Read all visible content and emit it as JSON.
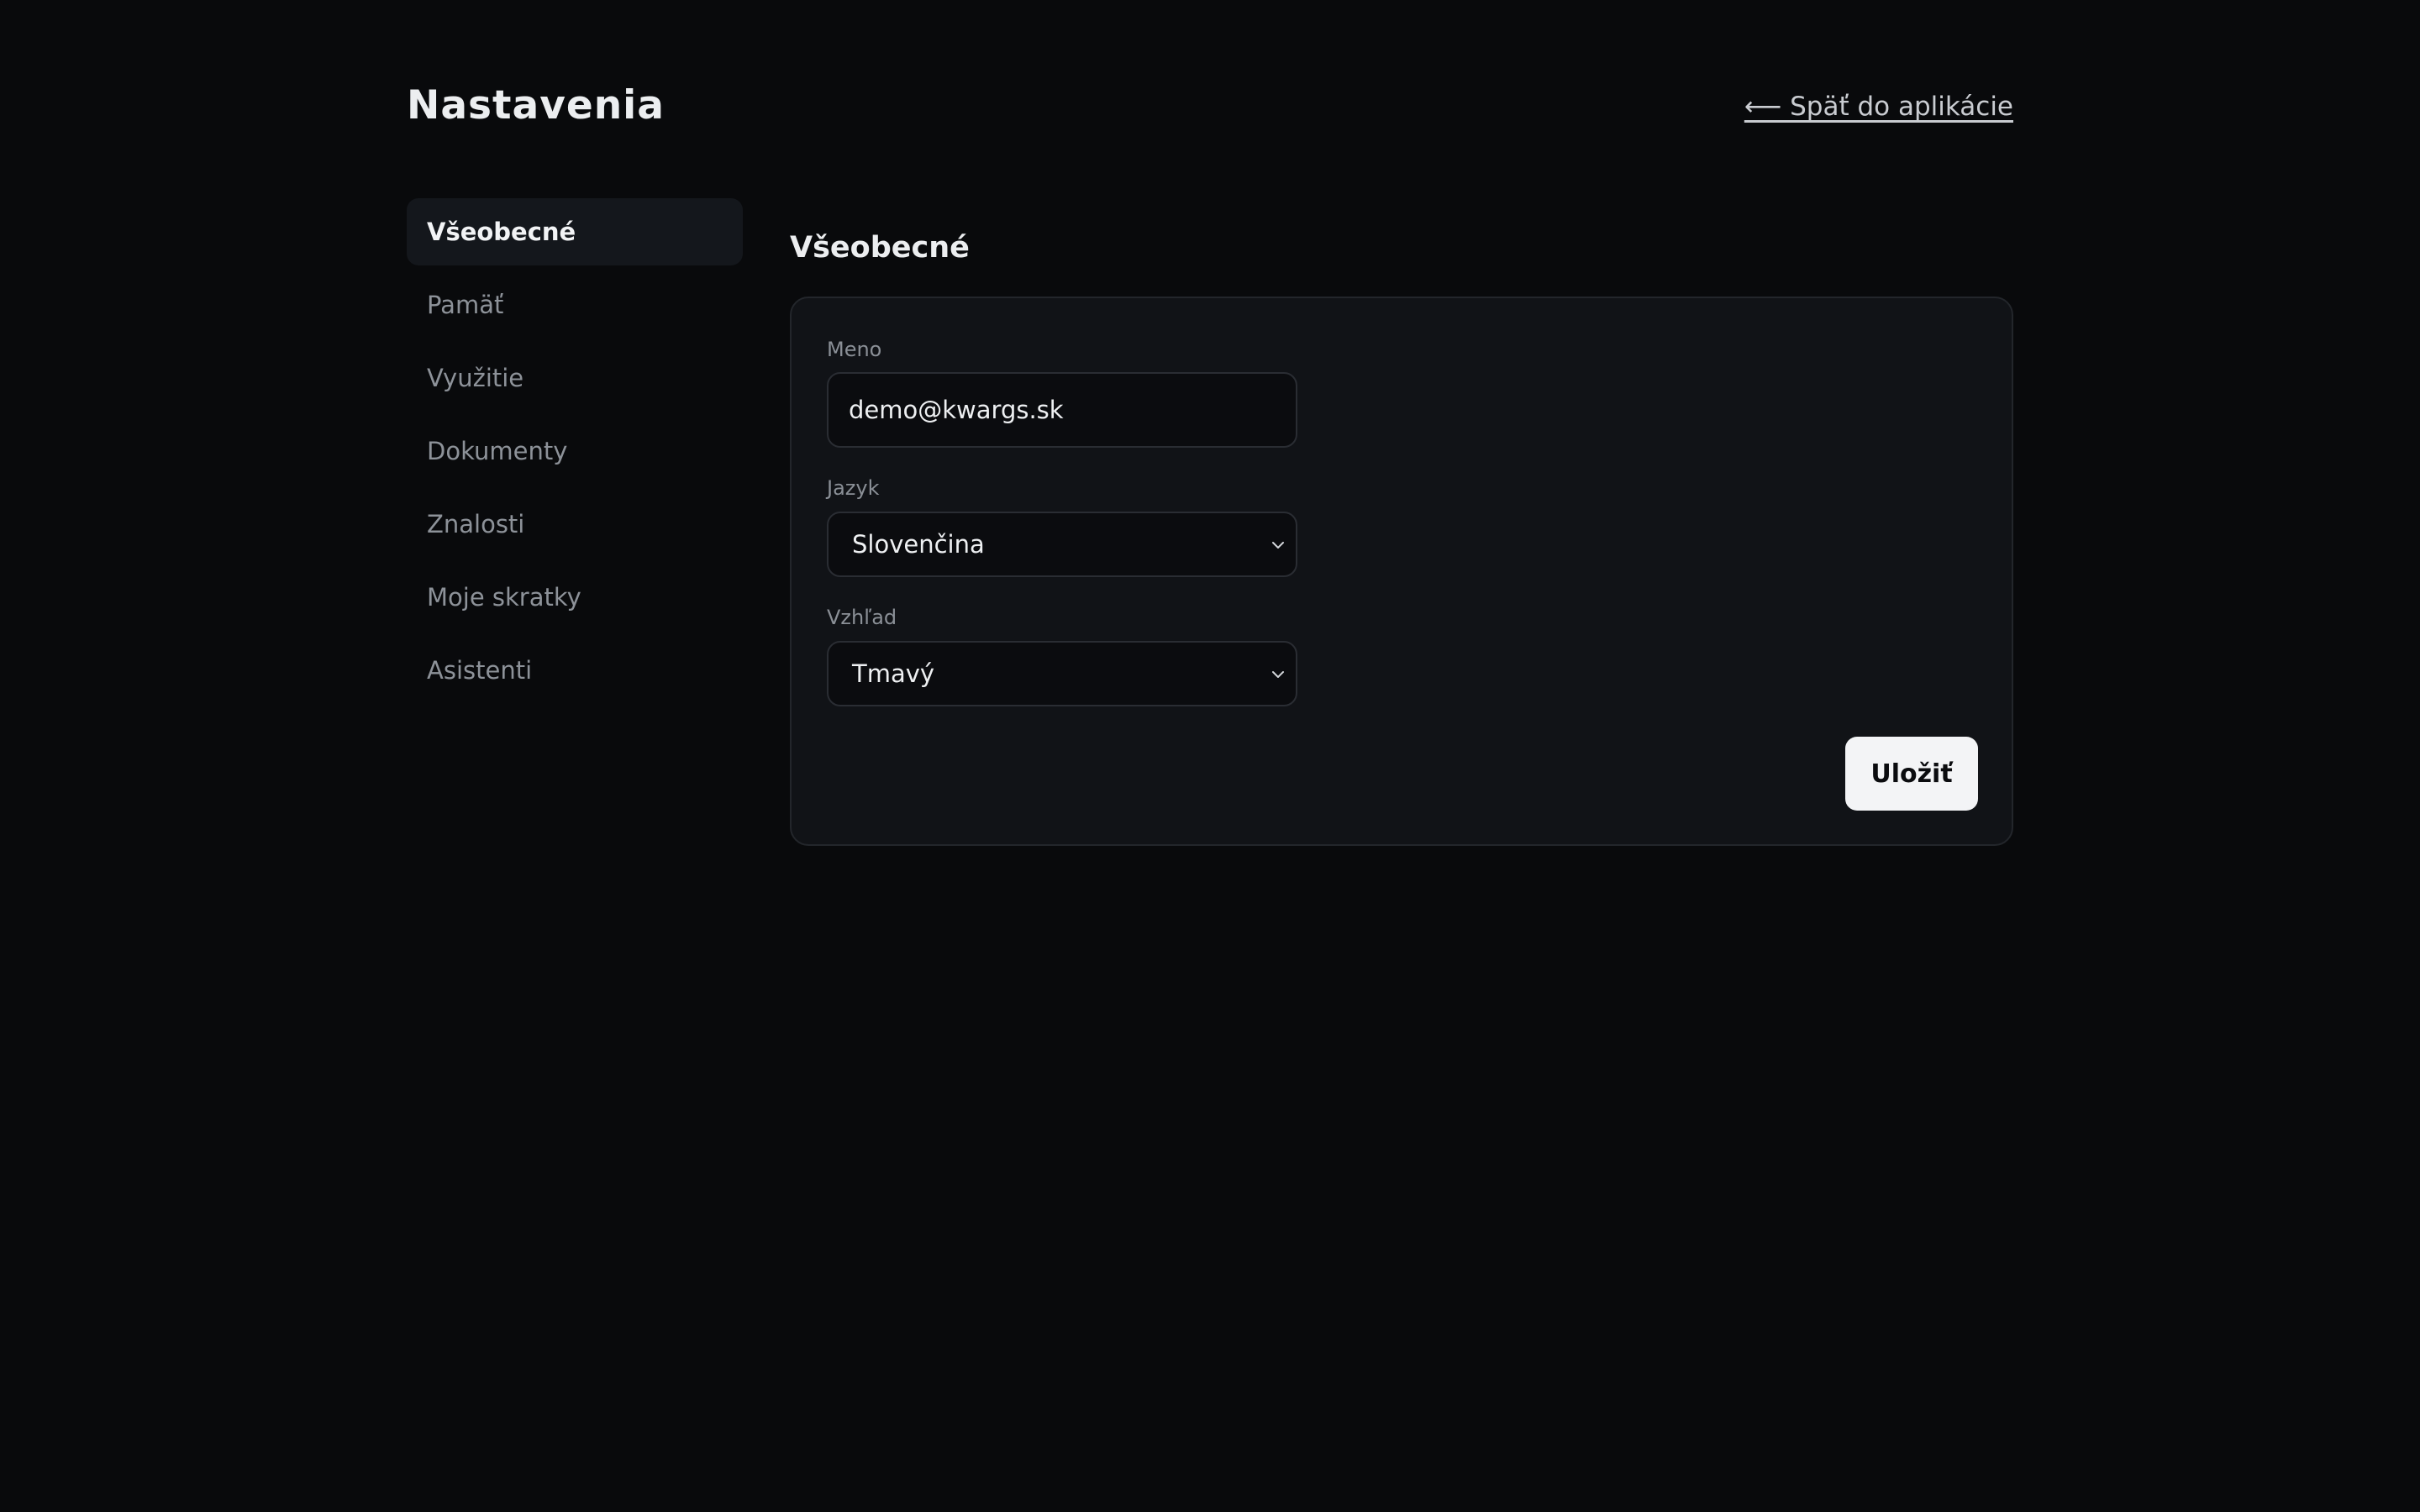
{
  "header": {
    "title": "Nastavenia",
    "back_link": "⟵ Späť do aplikácie"
  },
  "sidebar": {
    "items": [
      {
        "label": "Všeobecné",
        "active": true
      },
      {
        "label": "Pamäť",
        "active": false
      },
      {
        "label": "Využitie",
        "active": false
      },
      {
        "label": "Dokumenty",
        "active": false
      },
      {
        "label": "Znalosti",
        "active": false
      },
      {
        "label": "Moje skratky",
        "active": false
      },
      {
        "label": "Asistenti",
        "active": false
      }
    ]
  },
  "main": {
    "section_title": "Všeobecné",
    "fields": {
      "name": {
        "label": "Meno",
        "value": "demo@kwargs.sk"
      },
      "language": {
        "label": "Jazyk",
        "value": "Slovenčina"
      },
      "appearance": {
        "label": "Vzhľad",
        "value": "Tmavý"
      }
    },
    "save_label": "Uložiť"
  },
  "colors": {
    "background": "#090a0c",
    "card": "#111317",
    "active_item": "#14171c",
    "button": "#f3f4f6"
  },
  "icons": {
    "select_chevron": "chevron-down-icon",
    "back_arrow": "arrow-left"
  }
}
